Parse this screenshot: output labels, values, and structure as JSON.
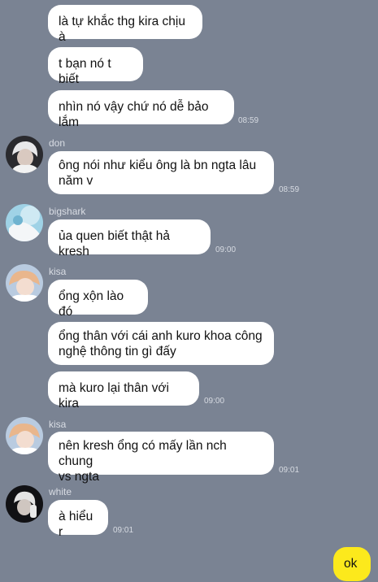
{
  "colors": {
    "background": "#7a8393",
    "incoming_bubble": "#ffffff",
    "outgoing_bubble": "#fce91c"
  },
  "messages": [
    {
      "text": "là tự khắc thg kira chịu à",
      "time": ""
    },
    {
      "text": "t bạn nó t biết",
      "time": ""
    },
    {
      "text": "nhìn nó vậy chứ nó dễ bảo lắm",
      "time": "08:59"
    },
    {
      "sender": "don",
      "avatar_icon": "user-avatar-icon",
      "text": "ông nói như kiểu ông là bn ngta lâu\nnăm v",
      "time": "08:59"
    },
    {
      "sender": "bigshark",
      "avatar_icon": "user-avatar-icon",
      "text": "ủa quen biết thật hả kresh",
      "time": "09:00"
    },
    {
      "sender": "kisa",
      "avatar_icon": "user-avatar-icon",
      "text": "ổng xộn lào đó",
      "time": ""
    },
    {
      "text": "ổng thân với cái anh kuro khoa công\nnghệ thông tin gì đấy",
      "time": ""
    },
    {
      "text": "mà kuro lại thân với kira",
      "time": "09:00"
    },
    {
      "sender": "kisa",
      "avatar_icon": "user-avatar-icon",
      "text": "nên kresh ổng có mấy lần nch chung\nvs ngta",
      "time": "09:01"
    },
    {
      "sender": "white",
      "avatar_icon": "user-avatar-icon",
      "text": "à hiểu r",
      "time": "09:01"
    },
    {
      "text": "ok",
      "time": ""
    }
  ]
}
